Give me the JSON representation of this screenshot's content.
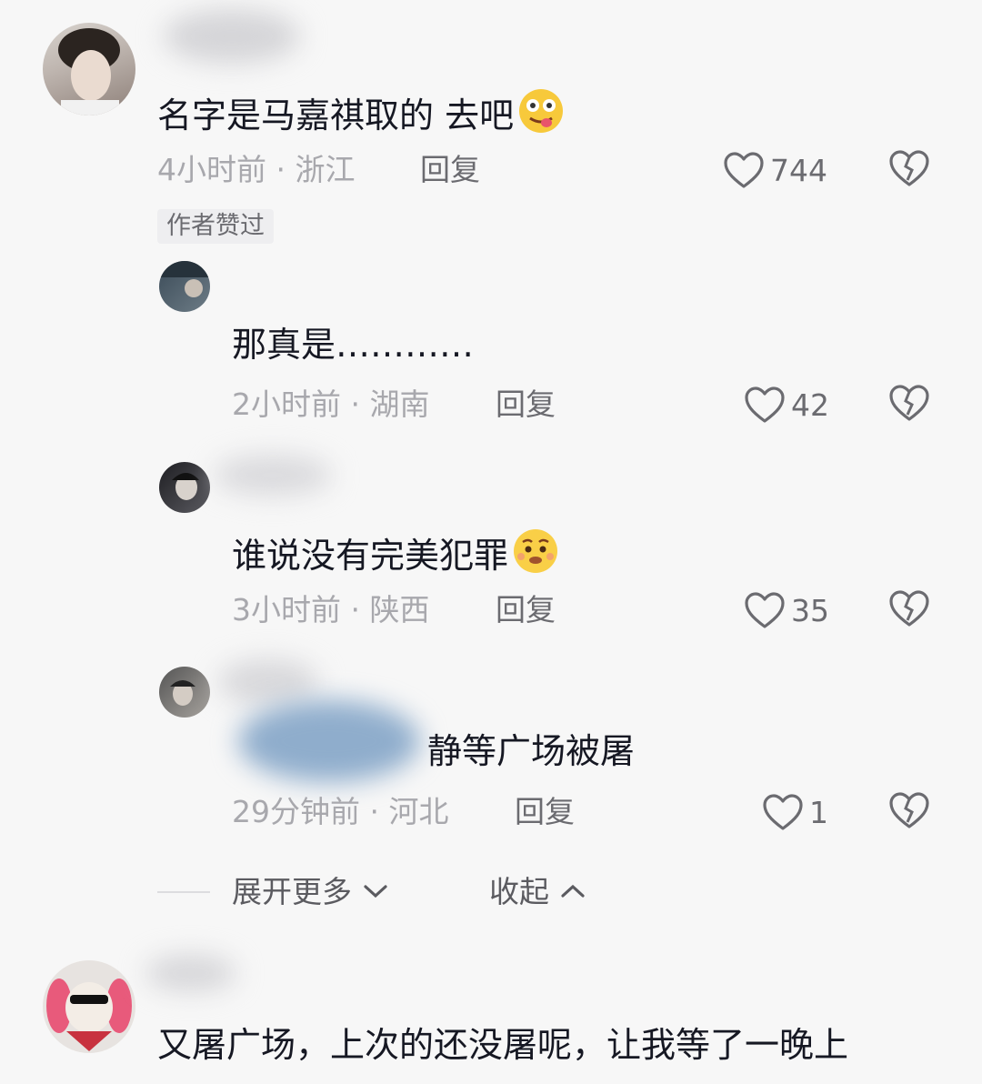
{
  "comments": [
    {
      "text": "名字是马嘉祺取的 去吧",
      "emoji": "tongue-out-dizzy-emoji",
      "time": "4小时前 · 浙江",
      "reply": "回复",
      "likes": "744",
      "badge": "作者赞过"
    },
    {
      "text": "那真是…………",
      "time": "2小时前 · 湖南",
      "reply": "回复",
      "likes": "42"
    },
    {
      "text": "谁说没有完美犯罪",
      "emoji": "pleading-emoji",
      "time": "3小时前 · 陕西",
      "reply": "回复",
      "likes": "35"
    },
    {
      "text": "静等广场被屠",
      "time": "29分钟前 · 河北",
      "reply": "回复",
      "likes": "1"
    },
    {
      "text": "又屠广场，上次的还没屠呢，让我等了一晚上"
    }
  ],
  "expand": {
    "more": "展开更多",
    "collapse": "收起"
  },
  "colors": {
    "text": "#161823",
    "meta": "#a8a8ad",
    "action": "#6b6b70",
    "background": "#f7f7f7"
  }
}
